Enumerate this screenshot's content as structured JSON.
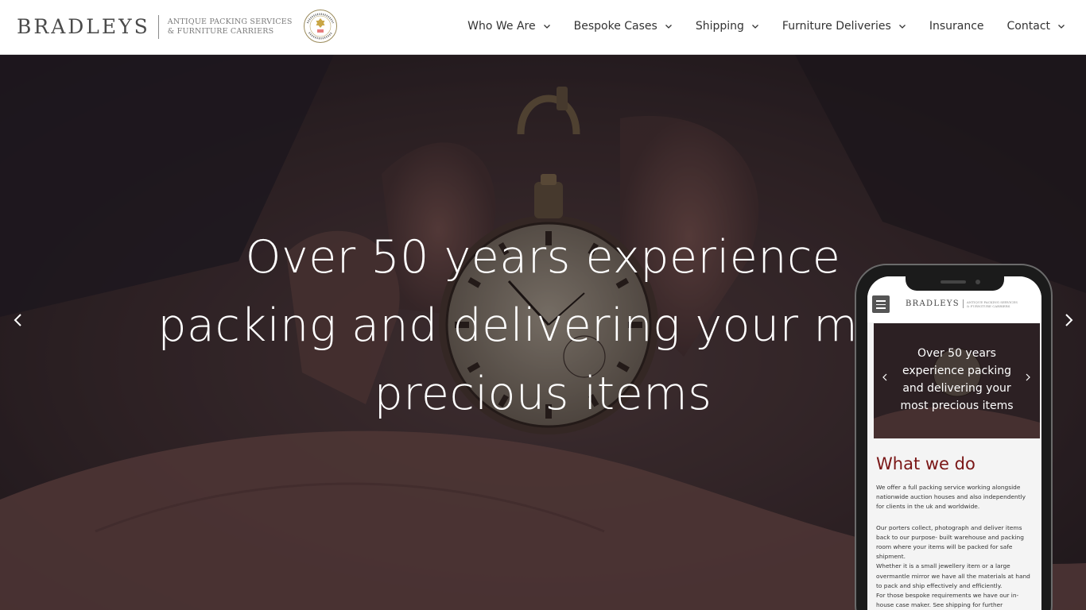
{
  "header": {
    "logo_word": "BRADLEYS",
    "logo_tagline": [
      "ANTIQUE PACKING SERVICES",
      "& FURNITURE CARRIERS"
    ],
    "seal_icon": "approved-service-seal-icon",
    "nav": [
      {
        "label": "Who We Are",
        "has_dropdown": true
      },
      {
        "label": "Bespoke Cases",
        "has_dropdown": true
      },
      {
        "label": "Shipping",
        "has_dropdown": true
      },
      {
        "label": "Furniture Deliveries",
        "has_dropdown": true
      },
      {
        "label": "Insurance",
        "has_dropdown": false
      },
      {
        "label": "Contact",
        "has_dropdown": true
      }
    ]
  },
  "hero": {
    "lines": [
      "Over 50 years experience",
      "packing and delivering your most",
      "precious items"
    ],
    "prev_icon": "chevron-left-icon",
    "next_icon": "chevron-right-icon"
  },
  "phone": {
    "logo_word": "BRADLEYS",
    "logo_tagline": [
      "ANTIQUE PACKING SERVICES",
      "& FURNITURE CARRIERS"
    ],
    "hero_lines": [
      "Over 50 years",
      "experience packing",
      "and delivering your",
      "most precious items"
    ],
    "heading": "What we do",
    "body_lines": [
      "We offer a full packing service working alongside",
      "nationwide auction houses and also independently",
      "for clients in the uk and worldwide.",
      "",
      "Our porters collect, photograph and deliver items",
      "back to our purpose- built warehouse and packing",
      "room where your items will be packed for safe",
      "shipment.",
      "Whether it is a small jewellery item or a large",
      "overmantle mirror we have all the materials at hand",
      "to pack and ship effectively and efficiently.",
      "For those bespoke requirements we have our in-",
      "house case maker. See shipping for further"
    ]
  },
  "colors": {
    "accent": "#7a1616",
    "nav_text": "#333333",
    "hero_overlay": "#2a1f21"
  }
}
